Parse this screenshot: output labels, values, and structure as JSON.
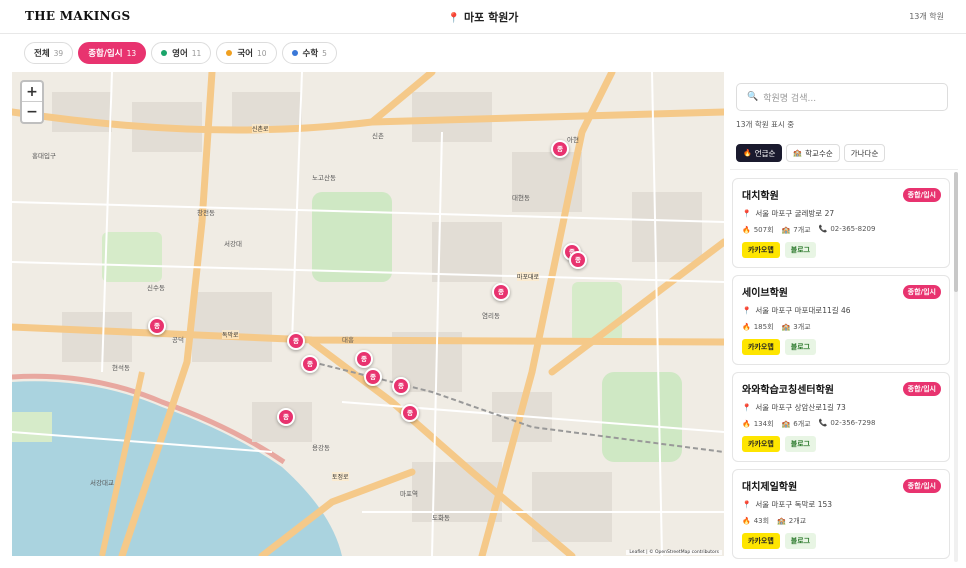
{
  "header": {
    "brand": "THE MAKINGS",
    "location": "마포 학원가",
    "total_count": "13개 학원"
  },
  "filters": [
    {
      "label": "전체",
      "count": "39",
      "active": false,
      "dot": ""
    },
    {
      "label": "종합/입시",
      "count": "13",
      "active": true,
      "dot": ""
    },
    {
      "label": "영어",
      "count": "11",
      "active": false,
      "dot": "#1aa56a"
    },
    {
      "label": "국어",
      "count": "10",
      "active": false,
      "dot": "#f0a020"
    },
    {
      "label": "수학",
      "count": "5",
      "active": false,
      "dot": "#3a78d8"
    }
  ],
  "map": {
    "zoom_in": "+",
    "zoom_out": "−",
    "marker_label": "종",
    "attribution": "Leaflet | © OpenStreetMap contributors",
    "labels": [
      "홍대입구",
      "신촌",
      "서강대",
      "공덕",
      "마포역",
      "대흥",
      "서강대교",
      "아현",
      "염리동",
      "도화동",
      "용강동",
      "현석동",
      "신수동",
      "노고산동",
      "창전동",
      "대현동",
      "마포대로",
      "토정로",
      "신촌로",
      "독막로"
    ]
  },
  "panel": {
    "search_placeholder": "학원명 검색...",
    "shown_text": "13개 학원 표시 중",
    "sorts": [
      {
        "label": "언급순",
        "icon": "fire-icon",
        "active": true
      },
      {
        "label": "학교수순",
        "icon": "school-icon",
        "active": false
      },
      {
        "label": "가나다순",
        "icon": "",
        "active": false
      }
    ],
    "cards": [
      {
        "name": "대치학원",
        "badge": "종합/입시",
        "address": "서울 마포구 굴레방로 27",
        "mentions": "507회",
        "schools": "7개교",
        "phone": "02-365-8209",
        "kakao": "카카오맵",
        "blog": "블로그"
      },
      {
        "name": "세이브학원",
        "badge": "종합/입시",
        "address": "서울 마포구 마포대로11길 46",
        "mentions": "185회",
        "schools": "3개교",
        "phone": "",
        "kakao": "카카오맵",
        "blog": "블로그"
      },
      {
        "name": "와와학습코칭센터학원",
        "badge": "종합/입시",
        "address": "서울 마포구 상암산로1길 73",
        "mentions": "134회",
        "schools": "6개교",
        "phone": "02-356-7298",
        "kakao": "카카오맵",
        "blog": "블로그"
      },
      {
        "name": "대치제일학원",
        "badge": "종합/입시",
        "address": "서울 마포구 독막로 153",
        "mentions": "43회",
        "schools": "2개교",
        "phone": "",
        "kakao": "카카오맵",
        "blog": "블로그"
      }
    ]
  },
  "colors": {
    "accent": "#e8336f",
    "kakao": "#fee500",
    "dark": "#1a1a2e"
  }
}
